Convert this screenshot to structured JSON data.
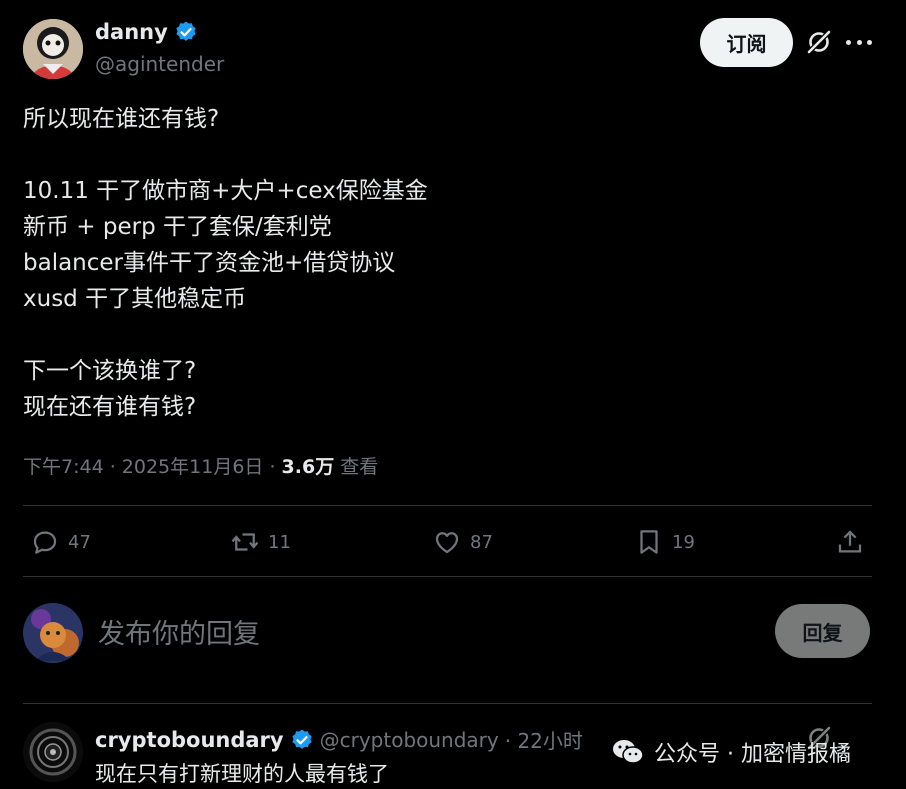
{
  "post": {
    "author_name": "danny",
    "author_handle": "@agintender",
    "subscribe_label": "订阅",
    "lines": [
      "所以现在谁还有钱?",
      "10.11 干了做市商+大户+cex保险基金",
      "新币 + perp 干了套保/套利党",
      "balancer事件干了资金池+借贷协议",
      "xusd 干了其他稳定币",
      "下一个该换谁了?",
      "现在还有谁有钱?"
    ],
    "time": "下午7:44 · 2025年11月6日 · ",
    "views_count": "3.6万",
    "views_label": " 查看"
  },
  "actions": {
    "replies": "47",
    "reposts": "11",
    "likes": "87",
    "bookmarks": "19"
  },
  "composer": {
    "placeholder": "发布你的回复",
    "reply_label": "回复"
  },
  "comment": {
    "author_name": "cryptoboundary",
    "author_handle": "@cryptoboundary",
    "time": "· 22小时",
    "text": "现在只有打新理财的人最有钱了"
  },
  "watermark": {
    "text": "公众号 · 加密情报橘"
  },
  "colors": {
    "verified": "#1d9bf0",
    "muted": "#71767b",
    "text": "#e7e9ea",
    "divider": "#2f3336"
  }
}
